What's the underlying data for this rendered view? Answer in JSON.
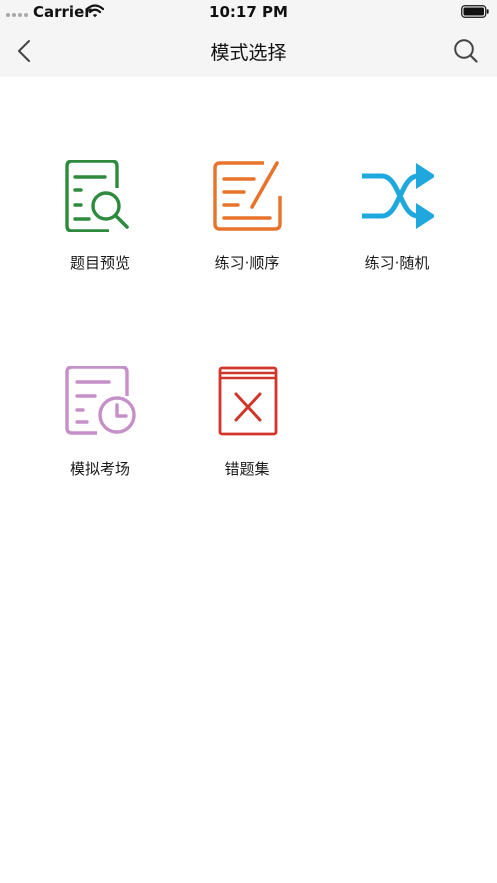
{
  "status_bar": {
    "carrier": "Carrier",
    "time": "10:17 PM"
  },
  "nav": {
    "title": "模式选择",
    "back_icon": "chevron-left-icon",
    "search_icon": "search-icon"
  },
  "modes": [
    {
      "label": "题目预览",
      "icon": "document-search-icon",
      "color": "#2e8b3e"
    },
    {
      "label": "练习·顺序",
      "icon": "document-edit-icon",
      "color": "#e8742c"
    },
    {
      "label": "练习·随机",
      "icon": "shuffle-icon",
      "color": "#1ea8de"
    },
    {
      "label": "模拟考场",
      "icon": "document-clock-icon",
      "color": "#c58fc8"
    },
    {
      "label": "错题集",
      "icon": "wrong-book-icon",
      "color": "#d2362b"
    }
  ]
}
